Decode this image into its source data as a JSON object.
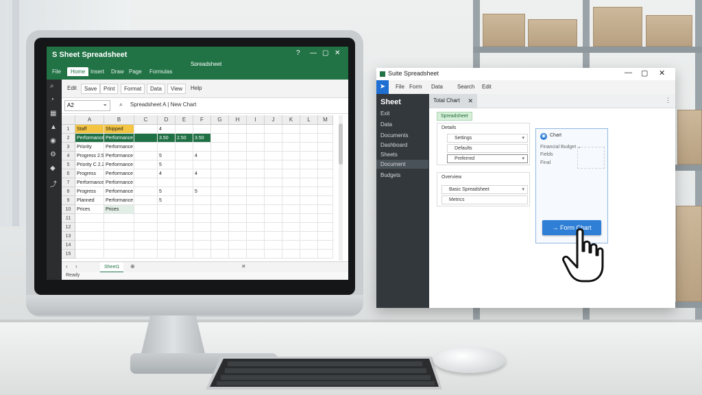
{
  "spreadsheet": {
    "app_title": "S Sheet Spreadsheet",
    "doc_title": "Spreadsheet",
    "window_controls": [
      "?",
      "—",
      "▢",
      "✕"
    ],
    "ribbon_tabs": [
      "File",
      "Home",
      "Insert",
      "Draw",
      "Page",
      "Formulas"
    ],
    "active_tab": "Home",
    "toolbar": [
      "Edit",
      "Save",
      "Print",
      "Format",
      "Data",
      "View",
      "Help"
    ],
    "namebox": "A2",
    "formula": "Spreadsheet A | New Chart",
    "columns": [
      "A",
      "B",
      "C",
      "D",
      "E",
      "F",
      "G",
      "H",
      "I",
      "J",
      "K",
      "L",
      "M"
    ],
    "rows": [
      {
        "num": "1",
        "cells": [
          "Staff",
          "Shipped",
          "",
          "4",
          "",
          ""
        ]
      },
      {
        "num": "2",
        "cells": [
          "Performance",
          "Performance",
          "",
          "3.50",
          "2.50",
          "3.50"
        ]
      },
      {
        "num": "3",
        "cells": [
          "Priority",
          "Performance",
          "",
          "",
          "",
          ""
        ]
      },
      {
        "num": "4",
        "cells": [
          "Progress 2.5",
          "Performance",
          "",
          "5",
          "",
          "4"
        ]
      },
      {
        "num": "5",
        "cells": [
          "Priority C 2.2",
          "Performance",
          "",
          "5",
          "",
          ""
        ]
      },
      {
        "num": "6",
        "cells": [
          "Progress",
          "Performance",
          "",
          "4",
          "",
          "4"
        ]
      },
      {
        "num": "7",
        "cells": [
          "Performance",
          "Performance",
          "",
          "",
          "",
          ""
        ]
      },
      {
        "num": "8",
        "cells": [
          "Progress",
          "Performance",
          "",
          "5",
          "",
          "5"
        ]
      },
      {
        "num": "9",
        "cells": [
          "Planned",
          "Performance",
          "",
          "5",
          "",
          ""
        ]
      },
      {
        "num": "10",
        "cells": [
          "Prices",
          "Prices",
          "",
          "",
          "",
          ""
        ]
      },
      {
        "num": "11",
        "cells": [
          "",
          "",
          "",
          "",
          "",
          ""
        ]
      },
      {
        "num": "12",
        "cells": [
          "",
          "",
          "",
          "",
          "",
          ""
        ]
      },
      {
        "num": "13",
        "cells": [
          "",
          "",
          "",
          "",
          "",
          ""
        ]
      },
      {
        "num": "14",
        "cells": [
          "",
          "",
          "",
          "",
          "",
          ""
        ]
      },
      {
        "num": "15",
        "cells": [
          "",
          "",
          "",
          "",
          "",
          ""
        ]
      }
    ],
    "sheet_tab": "Sheet1",
    "status": "Ready",
    "sidebar_icons": [
      "search-icon",
      "chart-icon",
      "grid-icon",
      "warning-icon",
      "camera-icon",
      "gear-icon",
      "tag-icon",
      "share-icon"
    ]
  },
  "dialog": {
    "title": "Suite Spreadsheet",
    "controls": [
      "—",
      "▢",
      "✕"
    ],
    "menu": [
      "File",
      "Form",
      "Data",
      "Search",
      "Edit"
    ],
    "brand": "Sheet",
    "sidebar_items": [
      "Exit",
      "Data",
      "Documents",
      "Dashboard",
      "Sheets",
      "Document",
      "Budgets"
    ],
    "active_sidebar": "Document",
    "tab_label": "Total Chart",
    "chip": "Spreadsheet",
    "group1_title": "Details",
    "group1_fields": [
      "Settings",
      "Defaults",
      "Preferred"
    ],
    "group2_title": "Overview",
    "group2_fields": [
      "Basic Spreadsheet",
      "Metrics"
    ],
    "card_title": "Chart",
    "card_lines": [
      "Financial Budget ⌄",
      "Fields",
      "Final"
    ],
    "primary_button": "Form Chart",
    "colors": {
      "spreadsheet_green": "#217346",
      "button_blue": "#2f7fd6",
      "sidebar_dark": "#33383d"
    }
  }
}
